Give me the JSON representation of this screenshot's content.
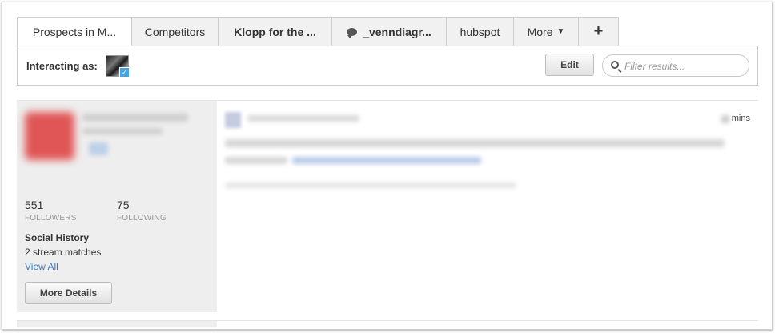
{
  "tabs": [
    {
      "label": "Prospects in M...",
      "active": true,
      "bold": false
    },
    {
      "label": "Competitors",
      "active": false,
      "bold": false
    },
    {
      "label": "Klopp for the ...",
      "active": false,
      "bold": true
    },
    {
      "label": "_venndiagr...",
      "active": false,
      "bold": true,
      "icon": "speech-bubble-icon"
    },
    {
      "label": "hubspot",
      "active": false,
      "bold": false
    },
    {
      "label": "More",
      "active": false,
      "bold": false,
      "icon": "chevron-down-icon"
    },
    {
      "label": "+",
      "active": false,
      "bold": true
    }
  ],
  "toolbar": {
    "interacting_label": "Interacting as:",
    "edit_label": "Edit",
    "filter_placeholder": "Filter results..."
  },
  "profile": {
    "followers_count": "551",
    "followers_label": "FOLLOWERS",
    "following_count": "75",
    "following_label": "FOLLOWING",
    "social_history_title": "Social History",
    "stream_matches": "2 stream matches",
    "view_all": "View All",
    "more_details": "More Details"
  },
  "stream": {
    "time_text": "mins"
  },
  "colors": {
    "link": "#3b78c2",
    "panel_bg": "#eeeeee",
    "tab_bg": "#f1f1f1"
  }
}
